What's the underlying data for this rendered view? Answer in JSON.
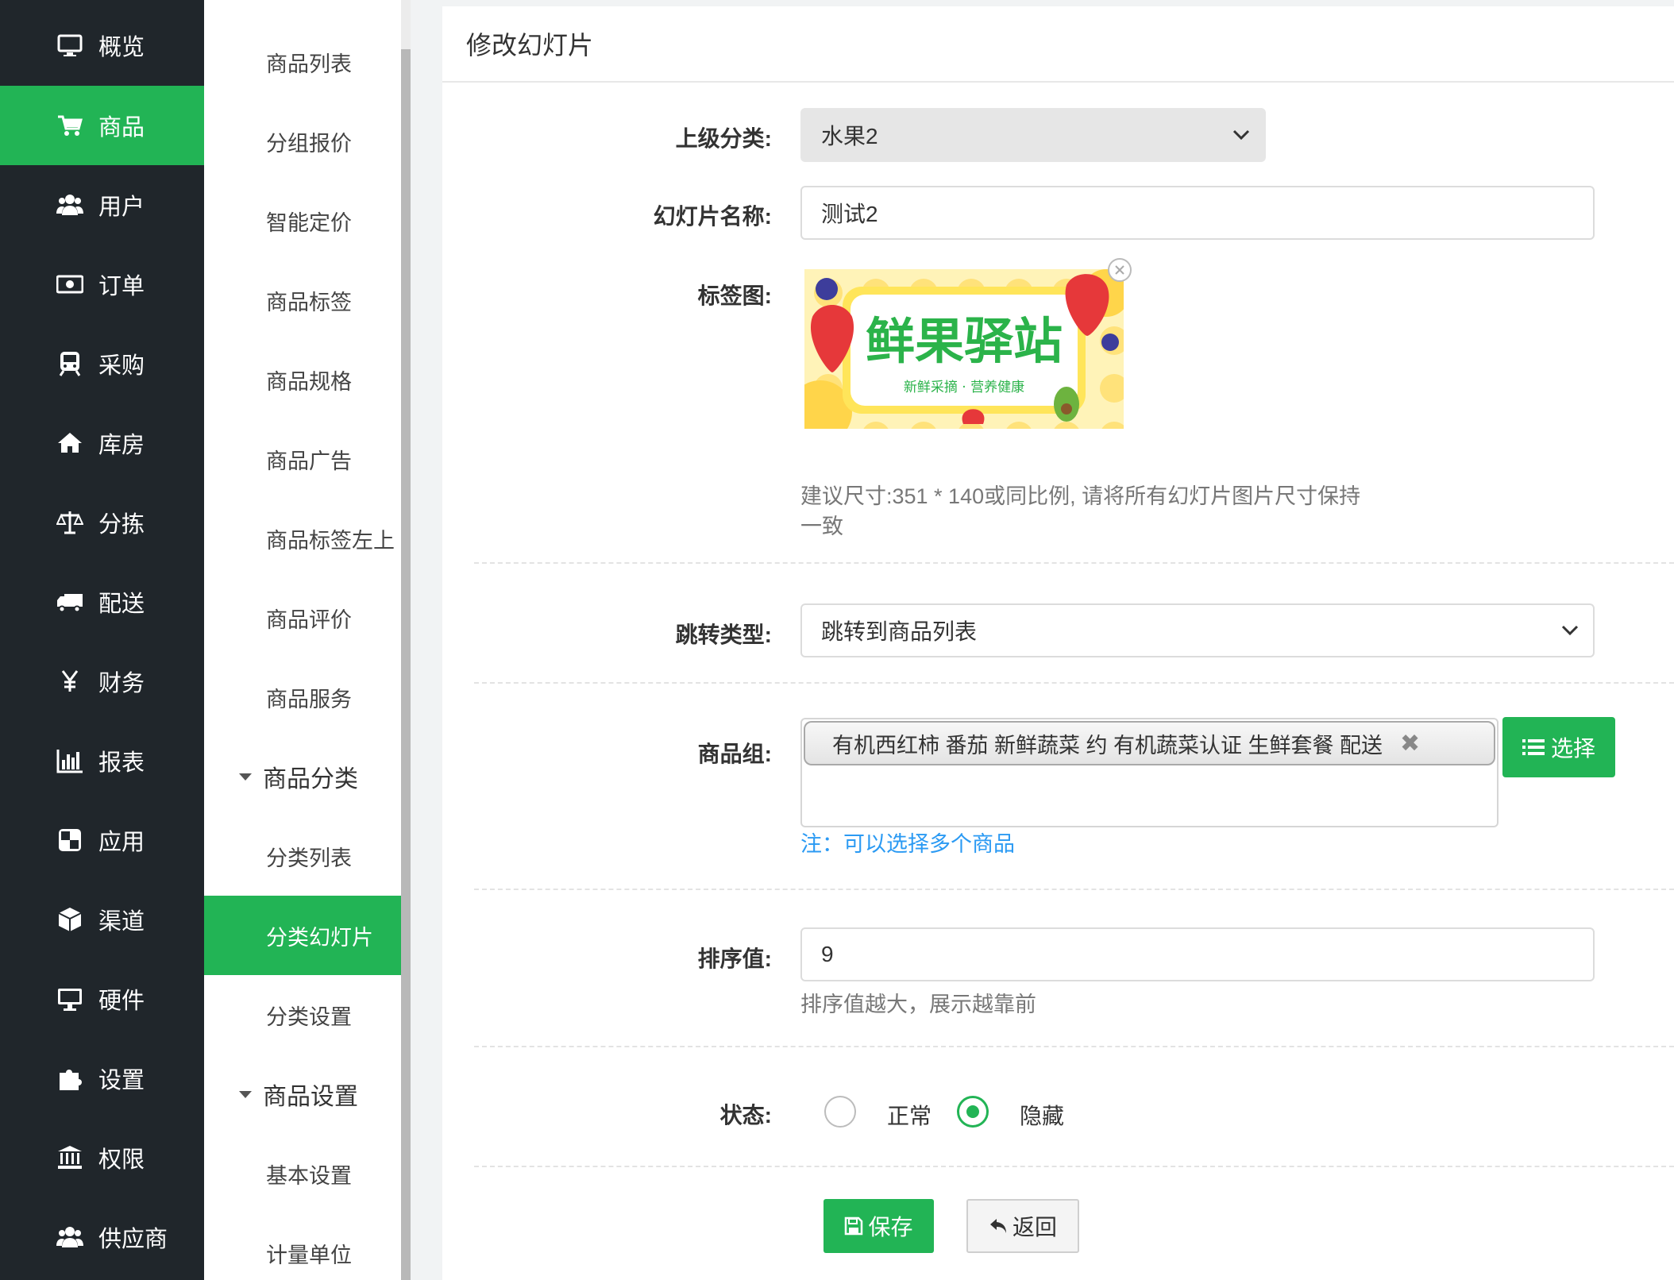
{
  "nav_primary": [
    {
      "label": "概览",
      "icon": "monitor-icon"
    },
    {
      "label": "商品",
      "icon": "cart-icon",
      "active": true
    },
    {
      "label": "用户",
      "icon": "users-icon"
    },
    {
      "label": "订单",
      "icon": "money-icon"
    },
    {
      "label": "采购",
      "icon": "train-icon"
    },
    {
      "label": "库房",
      "icon": "home-icon"
    },
    {
      "label": "分拣",
      "icon": "scale-icon"
    },
    {
      "label": "配送",
      "icon": "truck-icon"
    },
    {
      "label": "财务",
      "icon": "yen-icon"
    },
    {
      "label": "报表",
      "icon": "bar-chart-icon"
    },
    {
      "label": "应用",
      "icon": "apps-icon"
    },
    {
      "label": "渠道",
      "icon": "cube-icon"
    },
    {
      "label": "硬件",
      "icon": "desktop-icon"
    },
    {
      "label": "设置",
      "icon": "puzzle-icon"
    },
    {
      "label": "权限",
      "icon": "bank-icon"
    },
    {
      "label": "供应商",
      "icon": "users-icon"
    }
  ],
  "nav_secondary": [
    {
      "label": "商品列表"
    },
    {
      "label": "分组报价"
    },
    {
      "label": "智能定价"
    },
    {
      "label": "商品标签"
    },
    {
      "label": "商品规格"
    },
    {
      "label": "商品广告"
    },
    {
      "label": "商品标签左上"
    },
    {
      "label": "商品评价"
    },
    {
      "label": "商品服务"
    },
    {
      "label": "商品分类",
      "group": true
    },
    {
      "label": "分类列表"
    },
    {
      "label": "分类幻灯片",
      "active": true
    },
    {
      "label": "分类设置"
    },
    {
      "label": "商品设置",
      "group": true
    },
    {
      "label": "基本设置"
    },
    {
      "label": "计量单位"
    }
  ],
  "page": {
    "title": "修改幻灯片"
  },
  "form": {
    "parent_category": {
      "label": "上级分类:",
      "value": "水果2"
    },
    "slide_name": {
      "label": "幻灯片名称:",
      "value": "测试2"
    },
    "tag_image": {
      "label": "标签图:",
      "banner_text": "鲜果驿站",
      "banner_subtext": "新鲜采摘 · 营养健康",
      "hint_line1": "建议尺寸:351 * 140或同比例, 请将所有幻灯片图片尺寸保持",
      "hint_line2": "一致"
    },
    "jump_type": {
      "label": "跳转类型:",
      "value": "跳转到商品列表"
    },
    "product_group": {
      "label": "商品组:",
      "tag": "有机西红柿 番茄 新鲜蔬菜 约 有机蔬菜认证 生鲜套餐 配送",
      "tag_remove": "✖",
      "select_button": "选择",
      "note": "注：可以选择多个商品"
    },
    "sort": {
      "label": "排序值:",
      "value": "9",
      "hint": "排序值越大，展示越靠前"
    },
    "status": {
      "label": "状态:",
      "options": [
        {
          "label": "正常",
          "checked": false
        },
        {
          "label": "隐藏",
          "checked": true
        }
      ]
    }
  },
  "actions": {
    "save": "保存",
    "back": "返回"
  },
  "colors": {
    "brand_green": "#22b455",
    "sidebar_dark": "#20262b",
    "note_blue": "#2b9af3"
  }
}
